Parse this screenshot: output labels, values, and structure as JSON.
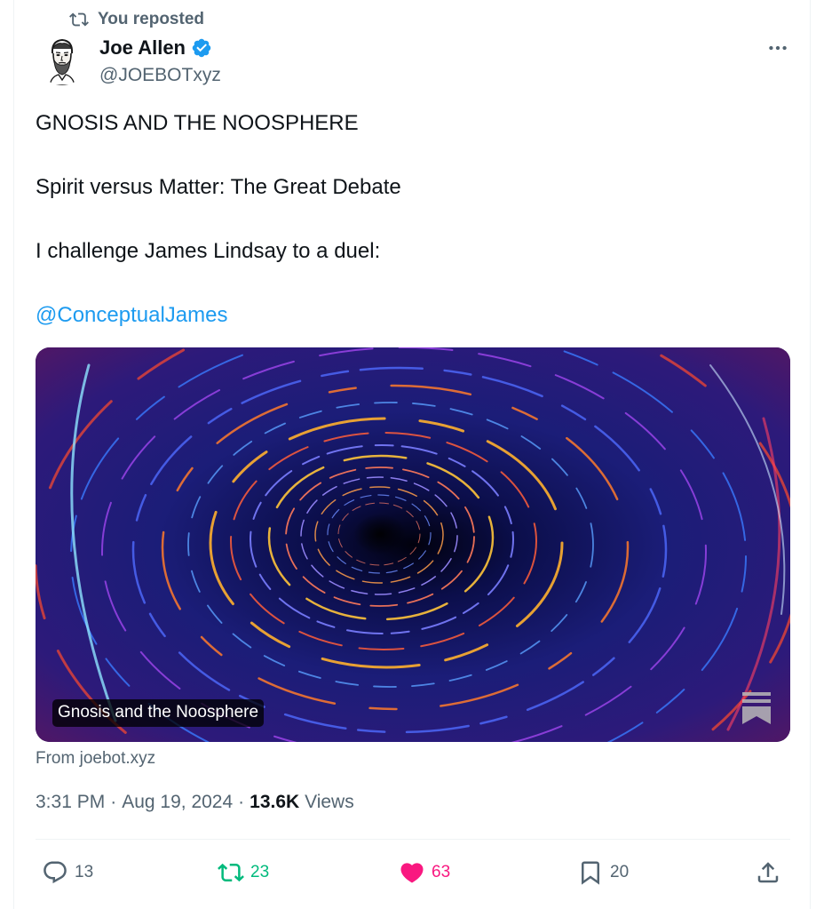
{
  "repost": {
    "label": "You reposted"
  },
  "author": {
    "name": "Joe Allen",
    "handle": "@JOEBOTxyz",
    "verified": true
  },
  "tweet": {
    "paragraphs": [
      "GNOSIS AND THE NOOSPHERE",
      "Spirit versus Matter: The Great Debate",
      "I challenge James Lindsay to a duel:"
    ],
    "mention": "@ConceptualJames"
  },
  "card": {
    "title": "Gnosis and the Noosphere",
    "source": "From joebot.xyz"
  },
  "meta": {
    "time": "3:31 PM",
    "separator1": "·",
    "date": "Aug 19, 2024",
    "separator2": "·",
    "views_count": "13.6K",
    "views_label": "Views"
  },
  "actions": {
    "replies": "13",
    "reposts": "23",
    "likes": "63",
    "bookmarks": "20"
  },
  "colors": {
    "accent": "#1d9bf0",
    "repost_active": "#00ba7c",
    "like_active": "#f91880",
    "secondary_text": "#536471"
  },
  "icons": {
    "repost_header": "repost-icon",
    "verified": "verified-badge-icon",
    "more": "more-dots-icon",
    "reply": "reply-bubble-icon",
    "repost": "repost-icon",
    "like": "heart-filled-icon",
    "bookmark": "bookmark-icon",
    "share": "share-upload-icon",
    "card_logo": "substack-logo-icon"
  }
}
